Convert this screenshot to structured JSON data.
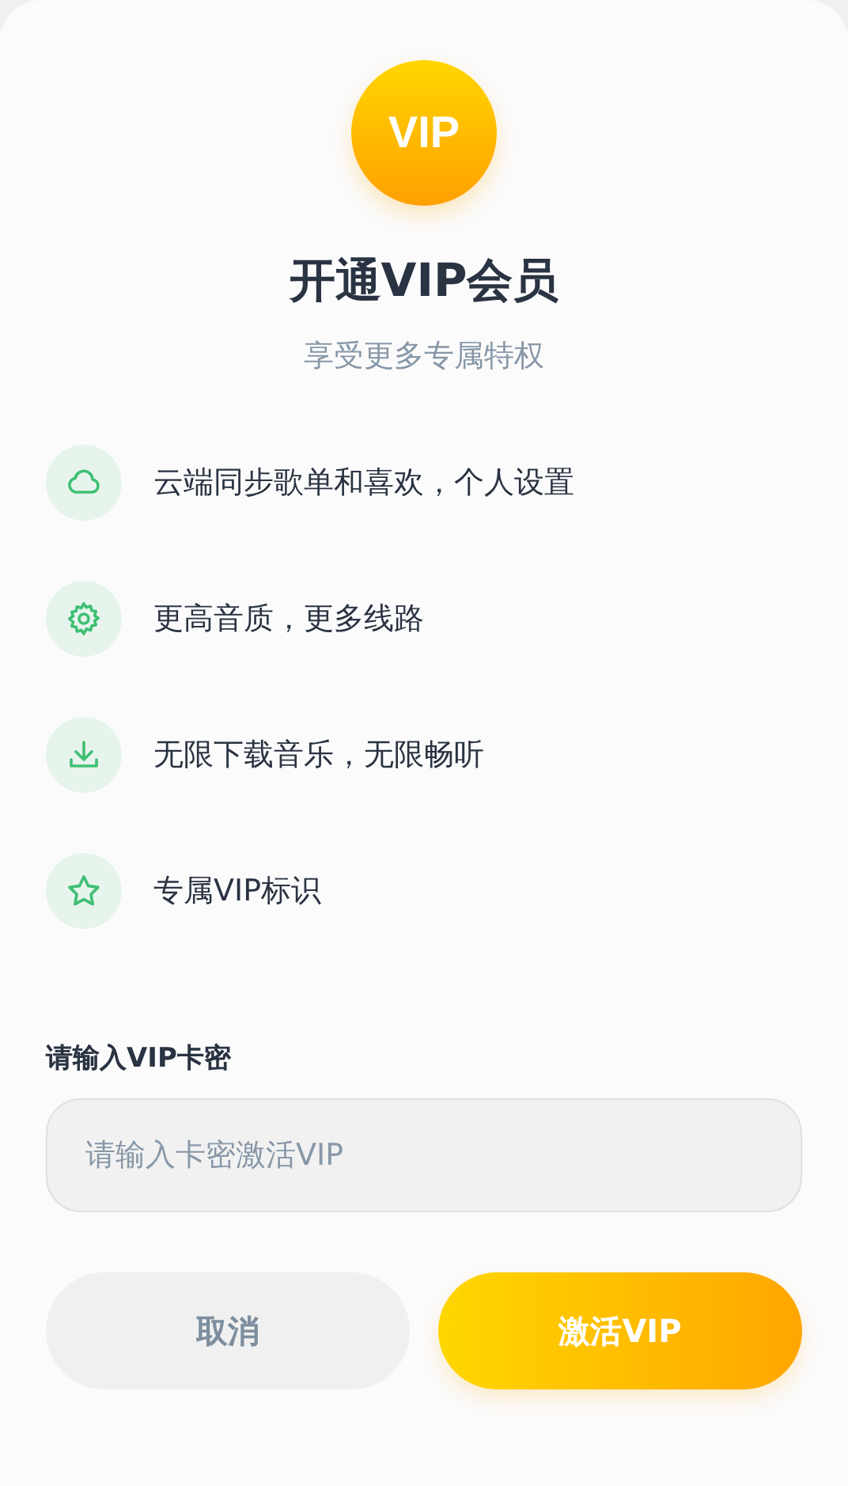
{
  "dialog": {
    "badge": "VIP",
    "title": "开通VIP会员",
    "subtitle": "享受更多专属特权",
    "features": [
      {
        "kind": "cloud",
        "text": "云端同步歌单和喜欢，个人设置"
      },
      {
        "kind": "gear",
        "text": "更高音质，更多线路"
      },
      {
        "kind": "download",
        "text": "无限下载音乐，无限畅听"
      },
      {
        "kind": "star",
        "text": "专属VIP标识"
      }
    ],
    "field_label": "请输入VIP卡密",
    "field": {
      "placeholder": "请输入卡密激活VIP"
    },
    "buttons": [
      {
        "kind": "secondary",
        "label": "取消"
      },
      {
        "kind": "primary",
        "label": "激活VIP"
      }
    ]
  }
}
